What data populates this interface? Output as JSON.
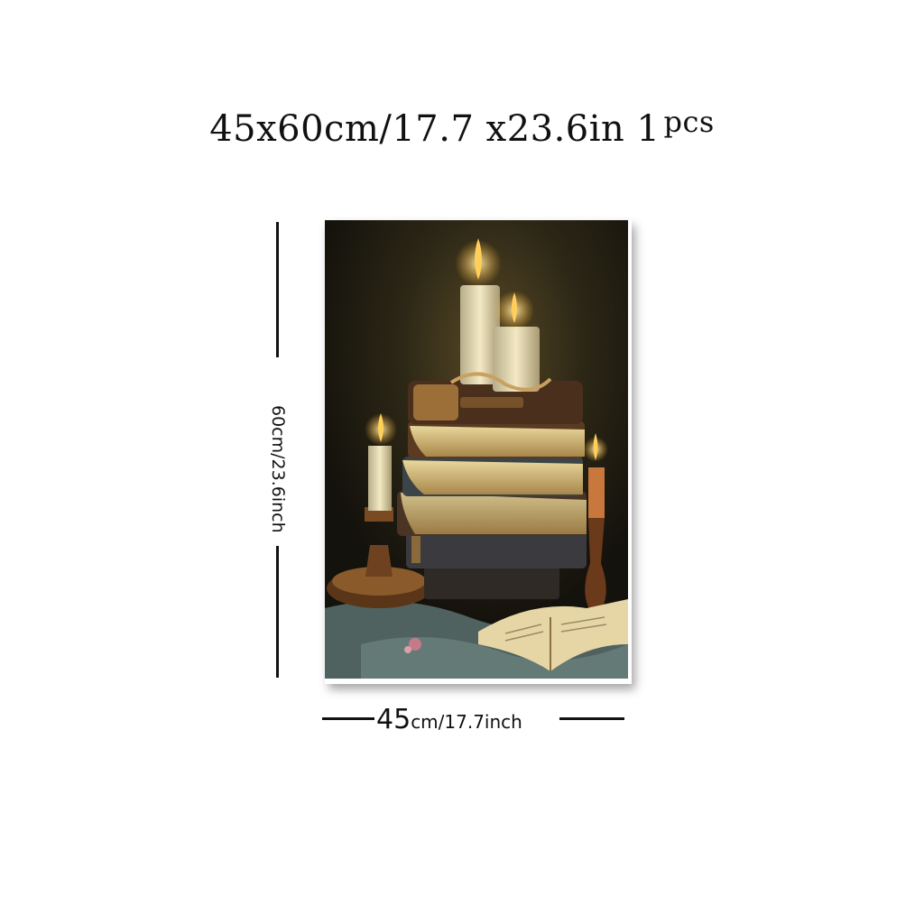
{
  "headline": {
    "size_text": "45x60cm/17.7 x23.6in",
    "qty_number": "1",
    "qty_unit": "pcs"
  },
  "dimensions": {
    "height_label": "60cm/23.6inch",
    "width_value": "45",
    "width_unit_text": "cm/17.7inch"
  },
  "artwork": {
    "palette": {
      "background": "#1d1a12",
      "flame": "#ffcf5a",
      "candle": "#e8dcb0",
      "book_dark": "#3b2a1c",
      "book_page": "#d9c48a",
      "cloth": "#5e7470",
      "brass": "#7a4a22"
    }
  }
}
